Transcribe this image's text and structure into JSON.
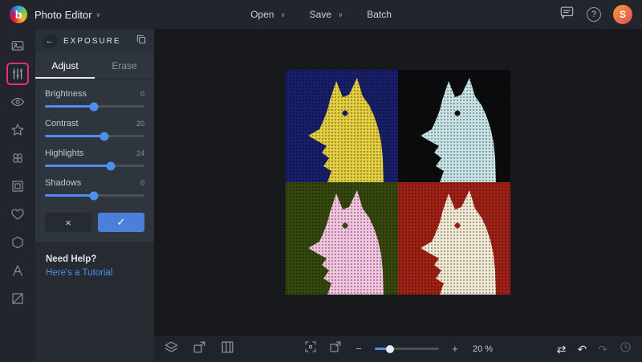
{
  "app": {
    "logo_letter": "b",
    "title": "Photo Editor"
  },
  "icons": {
    "chevron": "∨",
    "back": "←",
    "close": "×",
    "check": "✓",
    "minus": "−",
    "plus": "+",
    "undo": "↶",
    "redo": "↷",
    "compare": "⇄",
    "question": "?"
  },
  "topbar": {
    "menus": [
      {
        "label": "Open"
      },
      {
        "label": "Save"
      },
      {
        "label": "Batch"
      }
    ],
    "avatar_initial": "S"
  },
  "panel": {
    "title": "EXPOSURE",
    "tabs": [
      {
        "label": "Adjust"
      },
      {
        "label": "Erase"
      }
    ],
    "sliders": [
      {
        "label": "Brightness",
        "value": "0",
        "pct": "49%"
      },
      {
        "label": "Contrast",
        "value": "20",
        "pct": "60%"
      },
      {
        "label": "Highlights",
        "value": "24",
        "pct": "66%"
      },
      {
        "label": "Shadows",
        "value": "0",
        "pct": "49%"
      }
    ],
    "help_title": "Need Help?",
    "help_link": "Here's a Tutorial"
  },
  "canvas": {
    "quadrants": [
      {
        "bg": "#181f69",
        "fg": "#e4cf41"
      },
      {
        "bg": "#0c0c0e",
        "fg": "#c7e3e6"
      },
      {
        "bg": "#36490f",
        "fg": "#f4c4e0"
      },
      {
        "bg": "#a02116",
        "fg": "#f1e9d4"
      }
    ]
  },
  "bottombar": {
    "zoom_label": "20 %",
    "zoom_pct": "24%"
  },
  "colors": {
    "accent": "#4f8df0",
    "highlight": "#ee2a7b"
  }
}
